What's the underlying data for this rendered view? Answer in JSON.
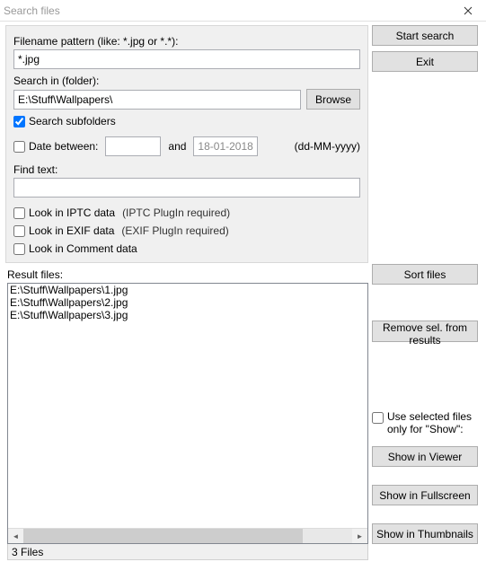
{
  "window": {
    "title": "Search files"
  },
  "labels": {
    "filename_pattern": "Filename pattern (like: *.jpg or *.*):",
    "search_in": "Search in (folder):",
    "search_subfolders": "Search subfolders",
    "date_between": "Date between:",
    "and": "and",
    "date_format": "(dd-MM-yyyy)",
    "find_text": "Find text:",
    "look_iptc": "Look in IPTC data",
    "look_iptc_note": "(IPTC PlugIn required)",
    "look_exif": "Look in EXIF data",
    "look_exif_note": "(EXIF PlugIn required)",
    "look_comment": "Look in Comment data",
    "result_files": "Result files:",
    "use_selected": "Use selected files only for \"Show\":"
  },
  "fields": {
    "pattern": "*.jpg",
    "folder": "E:\\Stuff\\Wallpapers\\",
    "date_from": "",
    "date_to": "18-01-2018",
    "find_text_value": ""
  },
  "checkboxes": {
    "subfolders": true,
    "date_between": false,
    "iptc": false,
    "exif": false,
    "comment": false,
    "use_selected": false
  },
  "buttons": {
    "browse": "Browse",
    "start_search": "Start search",
    "exit": "Exit",
    "sort_files": "Sort files",
    "remove_sel": "Remove sel. from results",
    "show_viewer": "Show in Viewer",
    "show_fullscreen": "Show in Fullscreen",
    "show_thumbnails": "Show in Thumbnails"
  },
  "results": {
    "items": [
      "E:\\Stuff\\Wallpapers\\1.jpg",
      "E:\\Stuff\\Wallpapers\\2.jpg",
      "E:\\Stuff\\Wallpapers\\3.jpg"
    ]
  },
  "status": {
    "text": "3  Files"
  }
}
